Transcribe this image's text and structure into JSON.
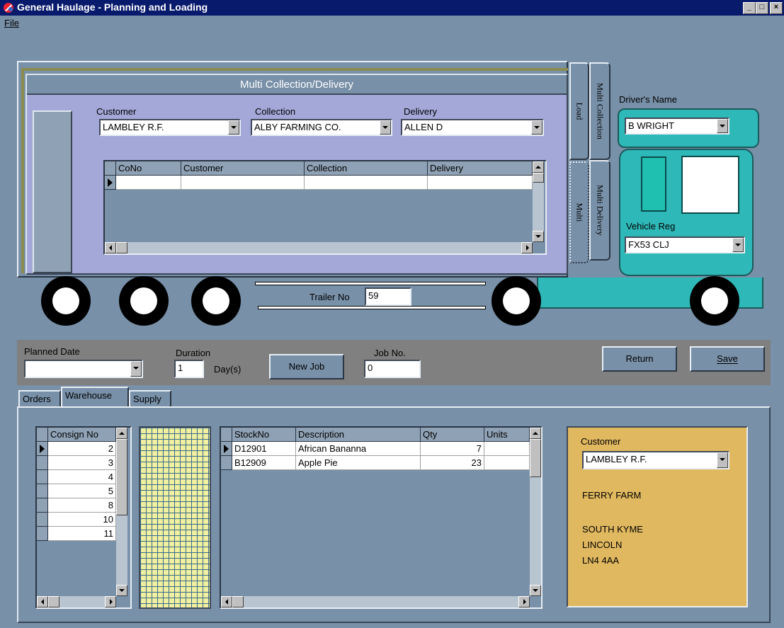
{
  "window": {
    "title": "General Haulage - Planning and Loading",
    "controls": [
      "_",
      "□",
      "×"
    ]
  },
  "menu": {
    "file": "File"
  },
  "multi_panel": {
    "title": "Multi Collection/Delivery",
    "customer_label": "Customer",
    "customer_value": "LAMBLEY R.F.",
    "collection_label": "Collection",
    "collection_value": "ALBY FARMING CO.",
    "delivery_label": "Delivery",
    "delivery_value": "ALLEN D",
    "grid_columns": [
      "CoNo",
      "Customer",
      "Collection",
      "Delivery"
    ]
  },
  "side_tabs": {
    "load": "Load",
    "multi": "Multi",
    "multi_collection": "Multi Collection",
    "multi_delivery": "Multi Delivery"
  },
  "cab": {
    "driver_label": "Driver's Name",
    "driver_value": "B WRIGHT",
    "vehicle_label": "Vehicle Reg",
    "vehicle_value": "FX53 CLJ",
    "color": "#2fb8b8"
  },
  "trailer": {
    "label": "Trailer No",
    "value": "59"
  },
  "job_bar": {
    "planned_date_label": "Planned Date",
    "planned_date_value": "",
    "duration_label": "Duration",
    "duration_value": "1",
    "duration_unit": "Day(s)",
    "new_job": "New Job",
    "job_no_label": "Job No.",
    "job_no_value": "0",
    "return": "Return",
    "save": "Save"
  },
  "tabs": {
    "orders": "Orders",
    "warehouse": "Warehouse",
    "supply": "Supply"
  },
  "consign_grid": {
    "header": "Consign No",
    "rows": [
      "2",
      "3",
      "4",
      "5",
      "8",
      "10",
      "11"
    ]
  },
  "stock_grid": {
    "columns": [
      "StockNo",
      "Description",
      "Qty",
      "Units"
    ],
    "rows": [
      {
        "stock_no": "D12901",
        "description": "African Bananna",
        "qty": "7",
        "units": ""
      },
      {
        "stock_no": "B12909",
        "description": "Apple Pie",
        "qty": "23",
        "units": ""
      }
    ]
  },
  "customer_panel": {
    "label": "Customer",
    "value": "LAMBLEY R.F.",
    "address_1": "FERRY FARM",
    "address_2": "SOUTH KYME",
    "address_3": "LINCOLN",
    "address_4": "LN4 4AA",
    "color": "#e0b860"
  }
}
